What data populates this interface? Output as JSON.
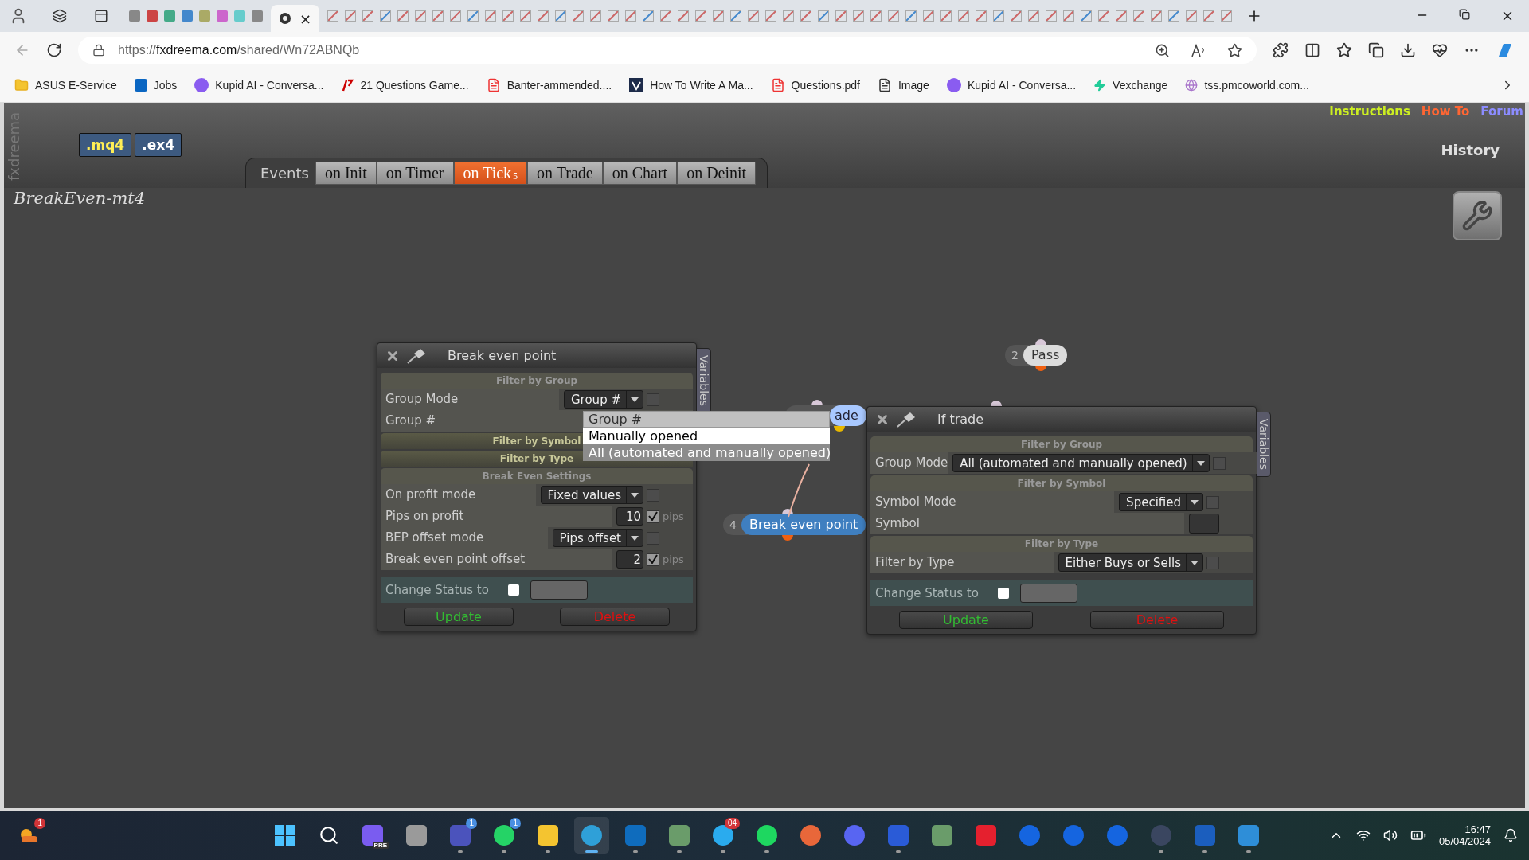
{
  "browser": {
    "active_tab_close": "×",
    "url": {
      "scheme": "https://",
      "host": "fxdreema.com",
      "path": "/shared/Wn72ABNQb"
    },
    "bookmarks": [
      {
        "label": "ASUS E-Service",
        "kind": "folder"
      },
      {
        "label": "Jobs",
        "kind": "linkedin"
      },
      {
        "label": "Kupid AI - Conversa...",
        "kind": "kupid"
      },
      {
        "label": "21 Questions Game...",
        "kind": "mark"
      },
      {
        "label": "Banter-ammended....",
        "kind": "pdf"
      },
      {
        "label": "How To Write A Ma...",
        "kind": "vee"
      },
      {
        "label": "Questions.pdf",
        "kind": "pdf"
      },
      {
        "label": "Image",
        "kind": "file"
      },
      {
        "label": "Kupid AI - Conversa...",
        "kind": "kupid"
      },
      {
        "label": "Vexchange",
        "kind": "bolt"
      },
      {
        "label": "tss.pmcoworld.com...",
        "kind": "globe"
      }
    ]
  },
  "header": {
    "brand": "fxdreema",
    "exports": [
      ".mq4",
      ".ex4"
    ],
    "events_label": "Events",
    "tabs": [
      {
        "label": "on Init",
        "selected": false
      },
      {
        "label": "on Timer",
        "selected": false
      },
      {
        "label": "on Tick",
        "selected": true,
        "count": "5"
      },
      {
        "label": "on Trade",
        "selected": false
      },
      {
        "label": "on Chart",
        "selected": false
      },
      {
        "label": "on Deinit",
        "selected": false
      }
    ],
    "links": [
      {
        "label": "Instructions",
        "color": "#ccee22"
      },
      {
        "label": "How To",
        "color": "#ff6633"
      },
      {
        "label": "Forum",
        "color": "#8c8cff"
      }
    ],
    "history": "History"
  },
  "project": {
    "title": "BreakEven-mt4"
  },
  "nodes": [
    {
      "number": "2",
      "label": "Pass",
      "kind": "pass"
    },
    {
      "label": "ade",
      "kind": "condition"
    },
    {
      "number": "4",
      "label": "Break even point",
      "kind": "action"
    }
  ],
  "dialogs": [
    {
      "title": "Break even point",
      "variables": "Variables",
      "sections": [
        {
          "title": "Filter by Group",
          "expanded": true,
          "rows": [
            {
              "kind": "select",
              "label": "Group Mode",
              "value": "Group #",
              "checked": false
            },
            {
              "kind": "label",
              "label": "Group #"
            }
          ]
        },
        {
          "title": "Filter by Symbol",
          "expanded": false
        },
        {
          "title": "Filter by Type",
          "expanded": false
        },
        {
          "title": "Break Even Settings",
          "expanded": true,
          "rows": [
            {
              "kind": "select",
              "label": "On profit mode",
              "value": "Fixed values",
              "checked": false
            },
            {
              "kind": "number",
              "label": "Pips on profit",
              "value": "10",
              "checked": true,
              "unit": "pips"
            },
            {
              "kind": "select",
              "label": "BEP offset mode",
              "value": "Pips offset",
              "checked": false
            },
            {
              "kind": "number",
              "label": "Break even point offset",
              "value": "2",
              "checked": true,
              "unit": "pips"
            }
          ]
        }
      ],
      "status": {
        "label": "Change Status to",
        "checked": false
      },
      "buttons": [
        {
          "label": "Update",
          "kind": "update"
        },
        {
          "label": "Delete",
          "kind": "delete"
        }
      ]
    },
    {
      "title": "If trade",
      "variables": "Variables",
      "sections": [
        {
          "title": "Filter by Group",
          "expanded": true,
          "rows": [
            {
              "kind": "select",
              "label": "Group Mode",
              "value": "All (automated and manually opened)",
              "checked": false
            }
          ]
        },
        {
          "title": "Filter by Symbol",
          "expanded": true,
          "rows": [
            {
              "kind": "select",
              "label": "Symbol Mode",
              "value": "Specified",
              "checked": false
            },
            {
              "kind": "field",
              "label": "Symbol"
            }
          ]
        },
        {
          "title": "Filter by Type",
          "expanded": true,
          "rows": [
            {
              "kind": "select",
              "label": "Filter by Type",
              "value": "Either Buys or Sells",
              "checked": false
            }
          ]
        }
      ],
      "status": {
        "label": "Change Status to",
        "checked": false
      },
      "buttons": [
        {
          "label": "Update",
          "kind": "update"
        },
        {
          "label": "Delete",
          "kind": "delete"
        }
      ]
    }
  ],
  "dropdown": {
    "options": [
      {
        "label": "Group #",
        "selected": true,
        "highlighted": false
      },
      {
        "label": "Manually opened",
        "selected": false,
        "highlighted": true
      },
      {
        "label": "All (automated and manually opened)",
        "selected": false,
        "highlighted": false
      }
    ]
  },
  "taskbar": {
    "widget_badge": "1",
    "apps": [
      {
        "kind": "start",
        "running": false,
        "active": false
      },
      {
        "kind": "search",
        "running": false,
        "active": false
      },
      {
        "kind": "app",
        "color": "#7a5cf0",
        "tag": "PRE",
        "running": false,
        "active": false
      },
      {
        "kind": "app",
        "color": "#9a9a9a",
        "running": false,
        "active": false
      },
      {
        "kind": "app",
        "color": "#4b53bc",
        "badge": "1",
        "running": true,
        "active": false
      },
      {
        "kind": "round",
        "color": "#25d366",
        "badge": "1",
        "running": true,
        "active": false
      },
      {
        "kind": "app",
        "color": "#f4c430",
        "running": true,
        "active": false
      },
      {
        "kind": "round",
        "color": "#2fa0d8",
        "running": true,
        "active": true
      },
      {
        "kind": "app",
        "color": "#0f6cbd",
        "running": true,
        "active": false
      },
      {
        "kind": "app",
        "color": "#6a9c6a",
        "running": true,
        "active": false
      },
      {
        "kind": "round",
        "color": "#2aabee",
        "badge": "04",
        "running": true,
        "active": false
      },
      {
        "kind": "round",
        "color": "#1ed760",
        "running": true,
        "active": false
      },
      {
        "kind": "round",
        "color": "#e8673a",
        "running": false,
        "active": false
      },
      {
        "kind": "round",
        "color": "#5865f2",
        "running": false,
        "active": false
      },
      {
        "kind": "app",
        "color": "#2a5bd7",
        "running": true,
        "active": false
      },
      {
        "kind": "app",
        "color": "#6a9c6a",
        "running": false,
        "active": false
      },
      {
        "kind": "app",
        "color": "#e5202e",
        "running": false,
        "active": false
      },
      {
        "kind": "round",
        "color": "#1565e0",
        "running": false,
        "active": false
      },
      {
        "kind": "round",
        "color": "#1565e0",
        "running": false,
        "active": false
      },
      {
        "kind": "round",
        "color": "#1565e0",
        "running": false,
        "active": false
      },
      {
        "kind": "round",
        "color": "#3a4660",
        "running": true,
        "active": false
      },
      {
        "kind": "app",
        "color": "#1b5ebe",
        "running": true,
        "active": false
      },
      {
        "kind": "app",
        "color": "#2e8ed8",
        "running": true,
        "active": false
      }
    ],
    "time": "16:47",
    "date": "05/04/2024"
  }
}
